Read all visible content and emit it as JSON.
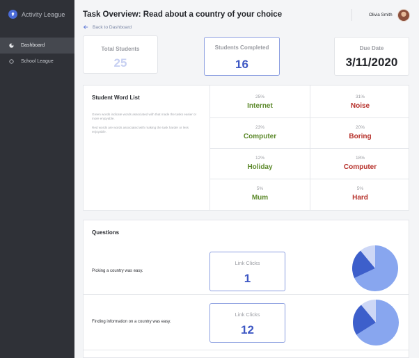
{
  "sidebar": {
    "brand": "Activity League",
    "items": [
      {
        "label": "Dashboard",
        "active": true,
        "icon": "pie-chart-icon"
      },
      {
        "label": "School League",
        "active": false,
        "icon": "circle-icon"
      }
    ]
  },
  "header": {
    "title": "Task Overview: Read about a country of your choice",
    "back_label": "Back to Dashboard",
    "user_name": "Olivia Smith"
  },
  "stats": [
    {
      "label": "Total Students",
      "value": "25",
      "color": "#c7d0f2"
    },
    {
      "label": "Students Completed",
      "value": "16",
      "color": "#3e58c4"
    },
    {
      "label": "Due Date",
      "value": "3/11/2020",
      "color": "#23252a"
    }
  ],
  "word_list": {
    "title": "Student Word List",
    "note_green": "Green words indicate words associated with that made the tasks easier or more enjoyable.",
    "note_red": "Red words are words associated with making the task harder or less enjoyable.",
    "rows": [
      {
        "left": {
          "pct": "25%",
          "word": "Internet"
        },
        "right": {
          "pct": "31%",
          "word": "Noise"
        }
      },
      {
        "left": {
          "pct": "23%",
          "word": "Computer"
        },
        "right": {
          "pct": "20%",
          "word": "Boring"
        }
      },
      {
        "left": {
          "pct": "12%",
          "word": "Holiday"
        },
        "right": {
          "pct": "18%",
          "word": "Computer"
        }
      },
      {
        "left": {
          "pct": "5%",
          "word": "Mum"
        },
        "right": {
          "pct": "5%",
          "word": "Hard"
        }
      }
    ]
  },
  "questions": {
    "title": "Questions",
    "items": [
      {
        "text": "Picking a country was easy.",
        "metric_label": "Link Clicks",
        "metric_value": "1",
        "pie": [
          0.68,
          0.21,
          0.11
        ]
      },
      {
        "text": "Finding information on a country was easy.",
        "metric_label": "Link Clicks",
        "metric_value": "12",
        "pie": [
          0.66,
          0.23,
          0.11
        ]
      }
    ],
    "pie_colors": [
      "#88a6ef",
      "#3d5fcb",
      "#cdd7f6"
    ]
  }
}
